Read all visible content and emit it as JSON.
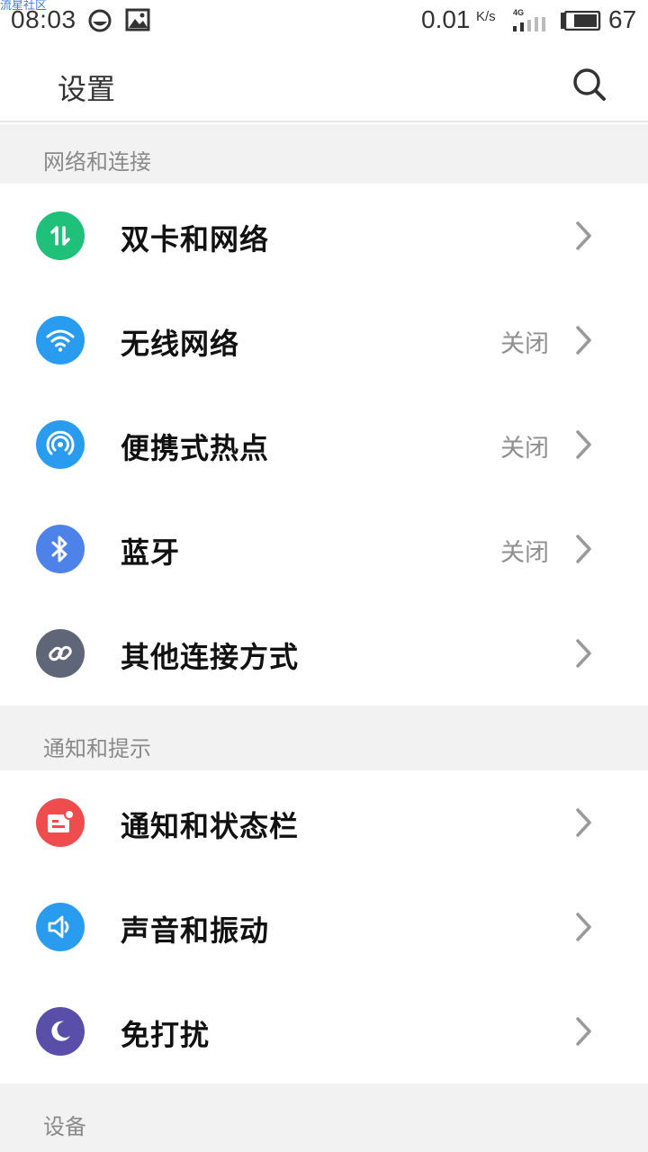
{
  "watermark": "流星社区",
  "status_bar": {
    "time": "08:03",
    "net_speed": "0.01",
    "net_speed_unit": "K/s",
    "network_type": "4G",
    "battery_level": "67",
    "icons": [
      "sync-icon",
      "image-icon",
      "signal-icon",
      "battery-icon"
    ]
  },
  "header": {
    "title": "设置",
    "search_icon": "search-icon"
  },
  "sections": [
    {
      "title": "网络和连接",
      "items": [
        {
          "label": "双卡和网络",
          "value": "",
          "icon": "dual-sim-icon",
          "color": "#1ec07a"
        },
        {
          "label": "无线网络",
          "value": "关闭",
          "icon": "wifi-icon",
          "color": "#2a9cf0"
        },
        {
          "label": "便携式热点",
          "value": "关闭",
          "icon": "hotspot-icon",
          "color": "#2a9cf0"
        },
        {
          "label": "蓝牙",
          "value": "关闭",
          "icon": "bluetooth-icon",
          "color": "#4d82e8"
        },
        {
          "label": "其他连接方式",
          "value": "",
          "icon": "link-icon",
          "color": "#5f6678"
        }
      ]
    },
    {
      "title": "通知和提示",
      "items": [
        {
          "label": "通知和状态栏",
          "value": "",
          "icon": "notification-icon",
          "color": "#ef4d4d"
        },
        {
          "label": "声音和振动",
          "value": "",
          "icon": "sound-icon",
          "color": "#2a9cf0"
        },
        {
          "label": "免打扰",
          "value": "",
          "icon": "moon-icon",
          "color": "#5a4fa8"
        }
      ]
    },
    {
      "title": "设备",
      "items": []
    }
  ]
}
